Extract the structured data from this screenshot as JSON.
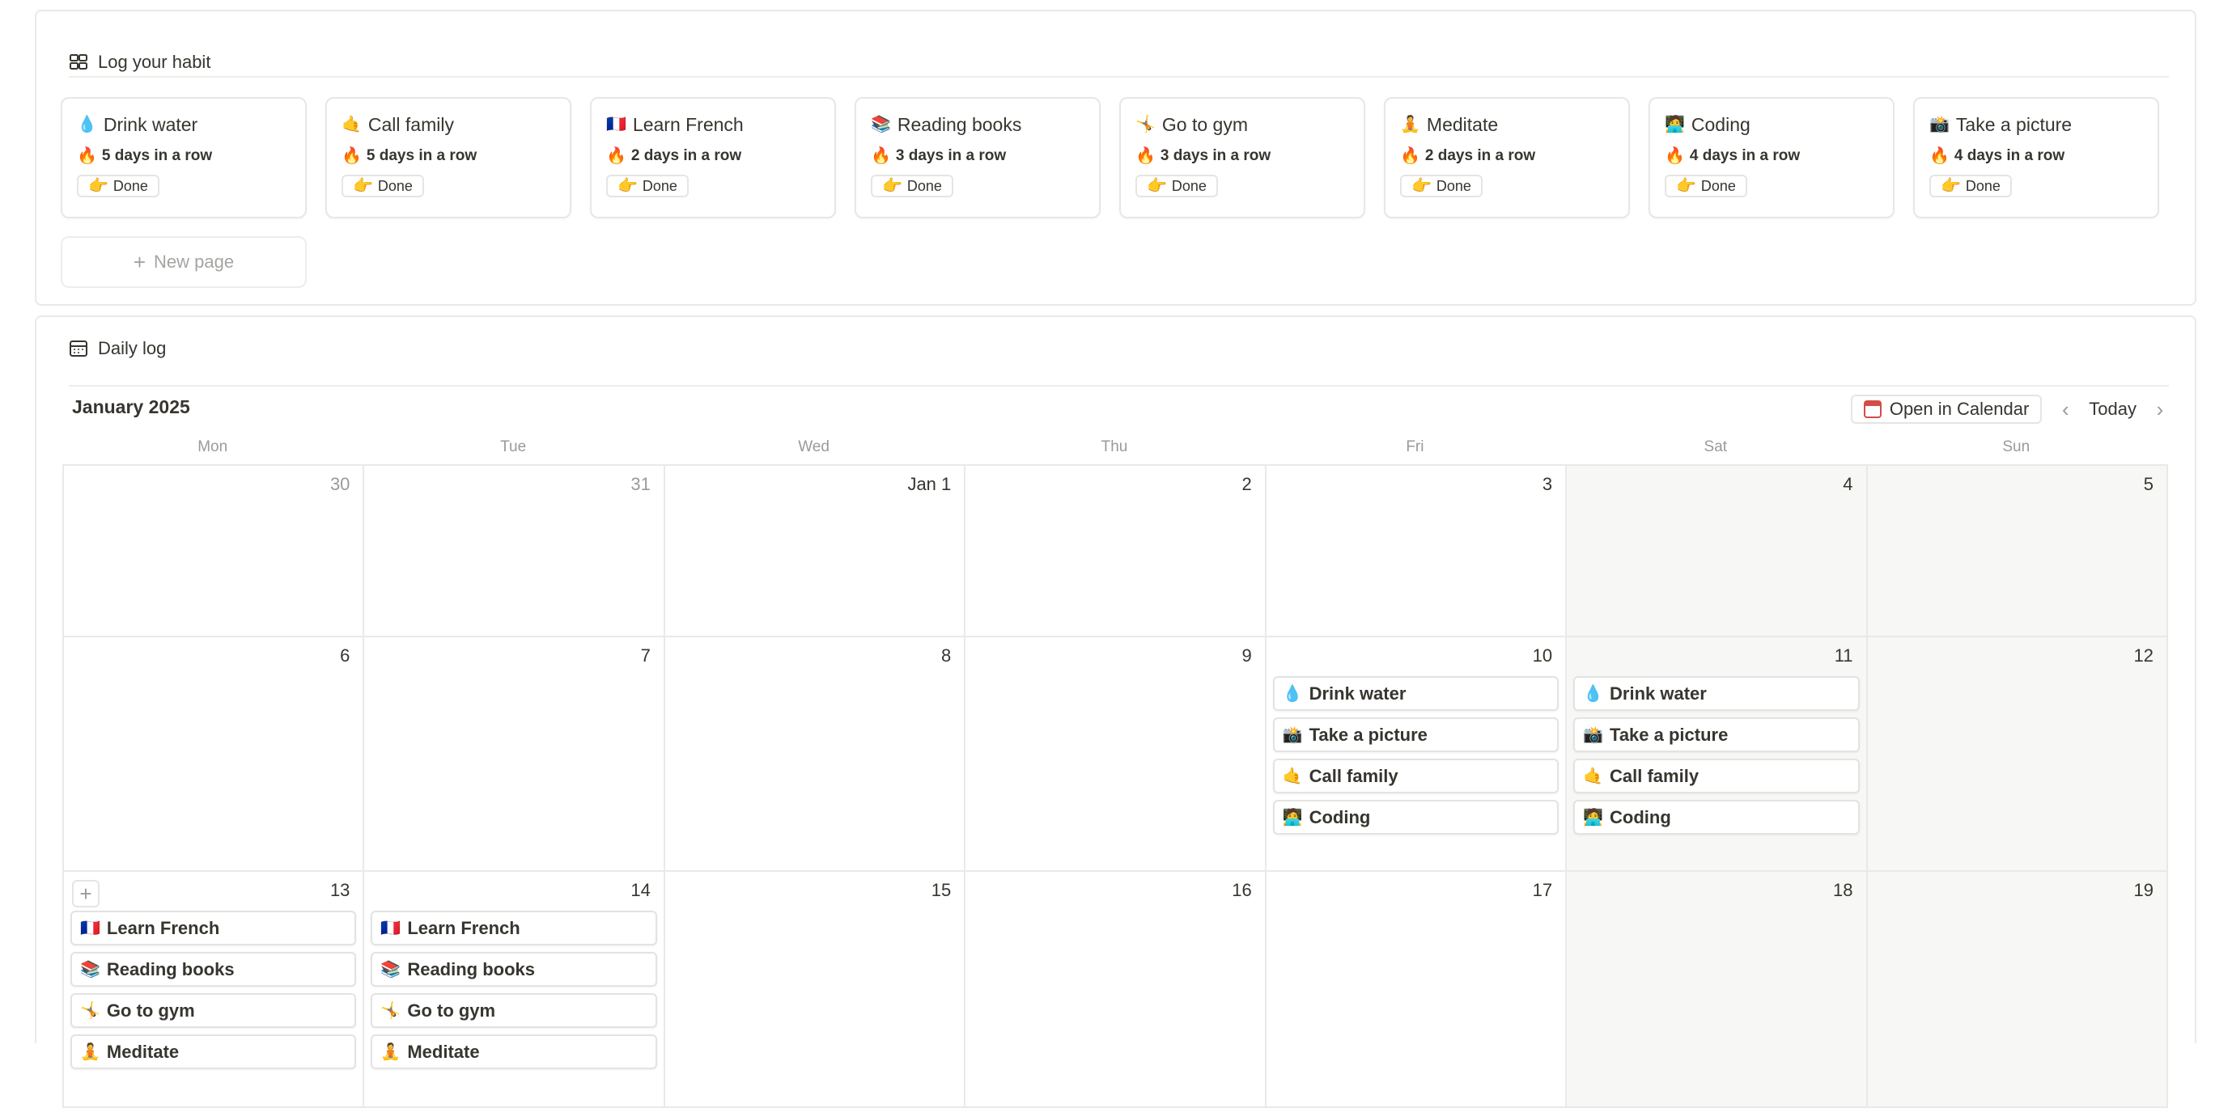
{
  "habits_section": {
    "title": "Log your habit",
    "new_page_label": "New page",
    "habits": [
      {
        "emoji": "💧",
        "name": "Drink water",
        "streak_emoji": "🔥",
        "streak": "5 days in a row",
        "button_emoji": "👉",
        "button": "Done"
      },
      {
        "emoji": "🤙",
        "name": "Call family",
        "streak_emoji": "🔥",
        "streak": "5 days in a row",
        "button_emoji": "👉",
        "button": "Done"
      },
      {
        "emoji": "🇫🇷",
        "name": "Learn French",
        "streak_emoji": "🔥",
        "streak": "2 days in a row",
        "button_emoji": "👉",
        "button": "Done"
      },
      {
        "emoji": "📚",
        "name": "Reading books",
        "streak_emoji": "🔥",
        "streak": "3 days in a row",
        "button_emoji": "👉",
        "button": "Done"
      },
      {
        "emoji": "🤸",
        "name": "Go to gym",
        "streak_emoji": "🔥",
        "streak": "3 days in a row",
        "button_emoji": "👉",
        "button": "Done"
      },
      {
        "emoji": "🧘",
        "name": "Meditate",
        "streak_emoji": "🔥",
        "streak": "2 days in a row",
        "button_emoji": "👉",
        "button": "Done"
      },
      {
        "emoji": "🧑‍💻",
        "name": "Coding",
        "streak_emoji": "🔥",
        "streak": "4 days in a row",
        "button_emoji": "👉",
        "button": "Done"
      },
      {
        "emoji": "📸",
        "name": "Take a picture",
        "streak_emoji": "🔥",
        "streak": "4 days in a row",
        "button_emoji": "👉",
        "button": "Done"
      }
    ]
  },
  "daily_log": {
    "title": "Daily log",
    "month": "January 2025",
    "open_calendar_label": "Open in Calendar",
    "today_label": "Today",
    "weekdays": [
      "Mon",
      "Tue",
      "Wed",
      "Thu",
      "Fri",
      "Sat",
      "Sun"
    ],
    "weeks": [
      [
        {
          "label": "30",
          "muted": true
        },
        {
          "label": "31",
          "muted": true
        },
        {
          "label": "Jan 1"
        },
        {
          "label": "2"
        },
        {
          "label": "3"
        },
        {
          "label": "4",
          "grey": true
        },
        {
          "label": "5",
          "grey": true
        }
      ],
      [
        {
          "label": "6"
        },
        {
          "label": "7"
        },
        {
          "label": "8"
        },
        {
          "label": "9"
        },
        {
          "label": "10",
          "events": [
            {
              "emoji": "💧",
              "name": "Drink water"
            },
            {
              "emoji": "📸",
              "name": "Take a picture"
            },
            {
              "emoji": "🤙",
              "name": "Call family"
            },
            {
              "emoji": "🧑‍💻",
              "name": "Coding"
            }
          ]
        },
        {
          "label": "11",
          "grey": true,
          "events": [
            {
              "emoji": "💧",
              "name": "Drink water"
            },
            {
              "emoji": "📸",
              "name": "Take a picture"
            },
            {
              "emoji": "🤙",
              "name": "Call family"
            },
            {
              "emoji": "🧑‍💻",
              "name": "Coding"
            }
          ]
        },
        {
          "label": "12",
          "grey": true
        }
      ],
      [
        {
          "label": "13",
          "add_button": "+",
          "events": [
            {
              "emoji": "🇫🇷",
              "name": "Learn French"
            },
            {
              "emoji": "📚",
              "name": "Reading books"
            },
            {
              "emoji": "🤸",
              "name": "Go to gym"
            },
            {
              "emoji": "🧘",
              "name": "Meditate"
            }
          ]
        },
        {
          "label": "14",
          "events": [
            {
              "emoji": "🇫🇷",
              "name": "Learn French"
            },
            {
              "emoji": "📚",
              "name": "Reading books"
            },
            {
              "emoji": "🤸",
              "name": "Go to gym"
            },
            {
              "emoji": "🧘",
              "name": "Meditate"
            }
          ]
        },
        {
          "label": "15"
        },
        {
          "label": "16"
        },
        {
          "label": "17"
        },
        {
          "label": "18",
          "grey": true
        },
        {
          "label": "19",
          "grey": true
        }
      ]
    ]
  }
}
